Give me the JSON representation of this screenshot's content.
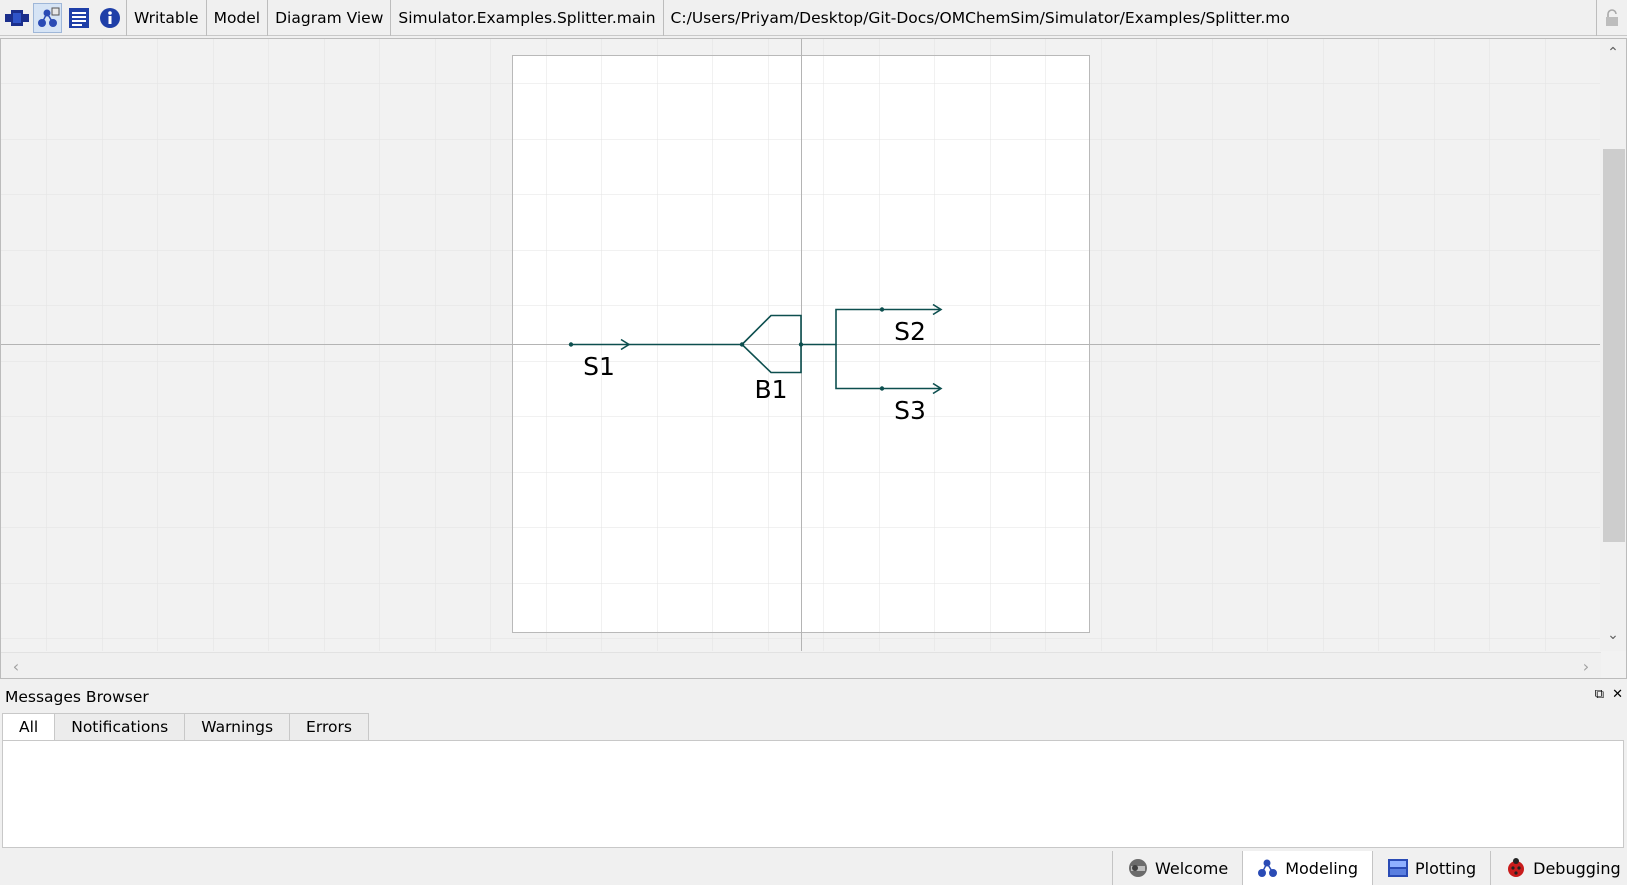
{
  "toolbar": {
    "icons": [
      "icon-view-icon",
      "diagram-view-icon",
      "text-view-icon",
      "documentation-icon"
    ],
    "access": "Writable",
    "restriction": "Model",
    "view": "Diagram View",
    "model_name": "Simulator.Examples.Splitter.main",
    "file_path": "C:/Users/Priyam/Desktop/Git-Docs/OMChemSim/Simulator/Examples/Splitter.mo"
  },
  "diagram": {
    "components": {
      "s1": "S1",
      "b1": "B1",
      "s2": "S2",
      "s3": "S3"
    },
    "line_color": "#0d4f4f"
  },
  "messages": {
    "title": "Messages Browser",
    "tabs": [
      "All",
      "Notifications",
      "Warnings",
      "Errors"
    ],
    "active_tab": "All"
  },
  "perspectives": {
    "items": [
      "Welcome",
      "Modeling",
      "Plotting",
      "Debugging"
    ],
    "active": "Modeling"
  }
}
